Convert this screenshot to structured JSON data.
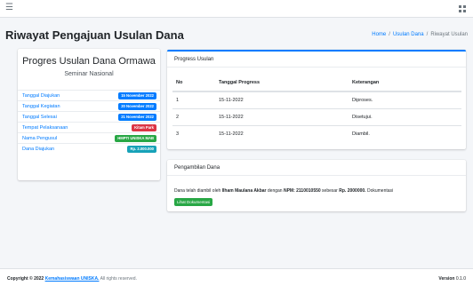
{
  "topbar": {
    "menu_icon": "hamburger-icon",
    "apps_icon": "grid-icon"
  },
  "page": {
    "title": "Riwayat Pengajuan Usulan Dana"
  },
  "breadcrumb": {
    "home": "Home",
    "usulan": "Usulan Dana",
    "current": "Riwayat Usulan"
  },
  "progres": {
    "title": "Progres Usulan Dana Ormawa",
    "subtitle": "Seminar Nasional",
    "rows": [
      {
        "label": "Tanggal Diajukan",
        "value": "15 November 2022"
      },
      {
        "label": "Tanggal Kegiatan",
        "value": "20 November 2022"
      },
      {
        "label": "Tanggal Selesai",
        "value": "21 November 2022"
      },
      {
        "label": "Tempat Pelaksanaan",
        "value": "Kitam Park"
      },
      {
        "label": "Nama Pengusul",
        "value": "HMPTI UNISKA MAB"
      },
      {
        "label": "Dana Diajukan",
        "value": "Rp. 2.000.000"
      }
    ]
  },
  "progress_card": {
    "header": "Progress Usulan",
    "columns": [
      "No",
      "Tanggal Progress",
      "Keterangan"
    ],
    "rows": [
      {
        "no": "1",
        "tanggal": "15-11-2022",
        "keterangan": "Diproses."
      },
      {
        "no": "2",
        "tanggal": "15-11-2022",
        "keterangan": "Disetujui."
      },
      {
        "no": "3",
        "tanggal": "15-11-2022",
        "keterangan": "Diambil."
      }
    ]
  },
  "pengambilan": {
    "header": "Pengambilan Dana",
    "text_1": "Dana telah diambil oleh ",
    "name": "Ilham Maulana Akbar",
    "text_2": " dengan ",
    "npm": "NPM: 2110010550",
    "text_3": " sebesar ",
    "amount": "Rp. 2000000.",
    "text_4": " Dokumentasi",
    "button": "Lihat Dokumentasi"
  },
  "footer": {
    "copyright": "Copyright © 2022 ",
    "brand": "Kemahasiswaan UNISKA.",
    "rights": " All rights reserved.",
    "version_label": "Version",
    "version": " 0.1.0"
  },
  "colors": {
    "primary": "#007bff",
    "danger": "#dc3545",
    "success": "#28a745",
    "info": "#17a2b8"
  }
}
